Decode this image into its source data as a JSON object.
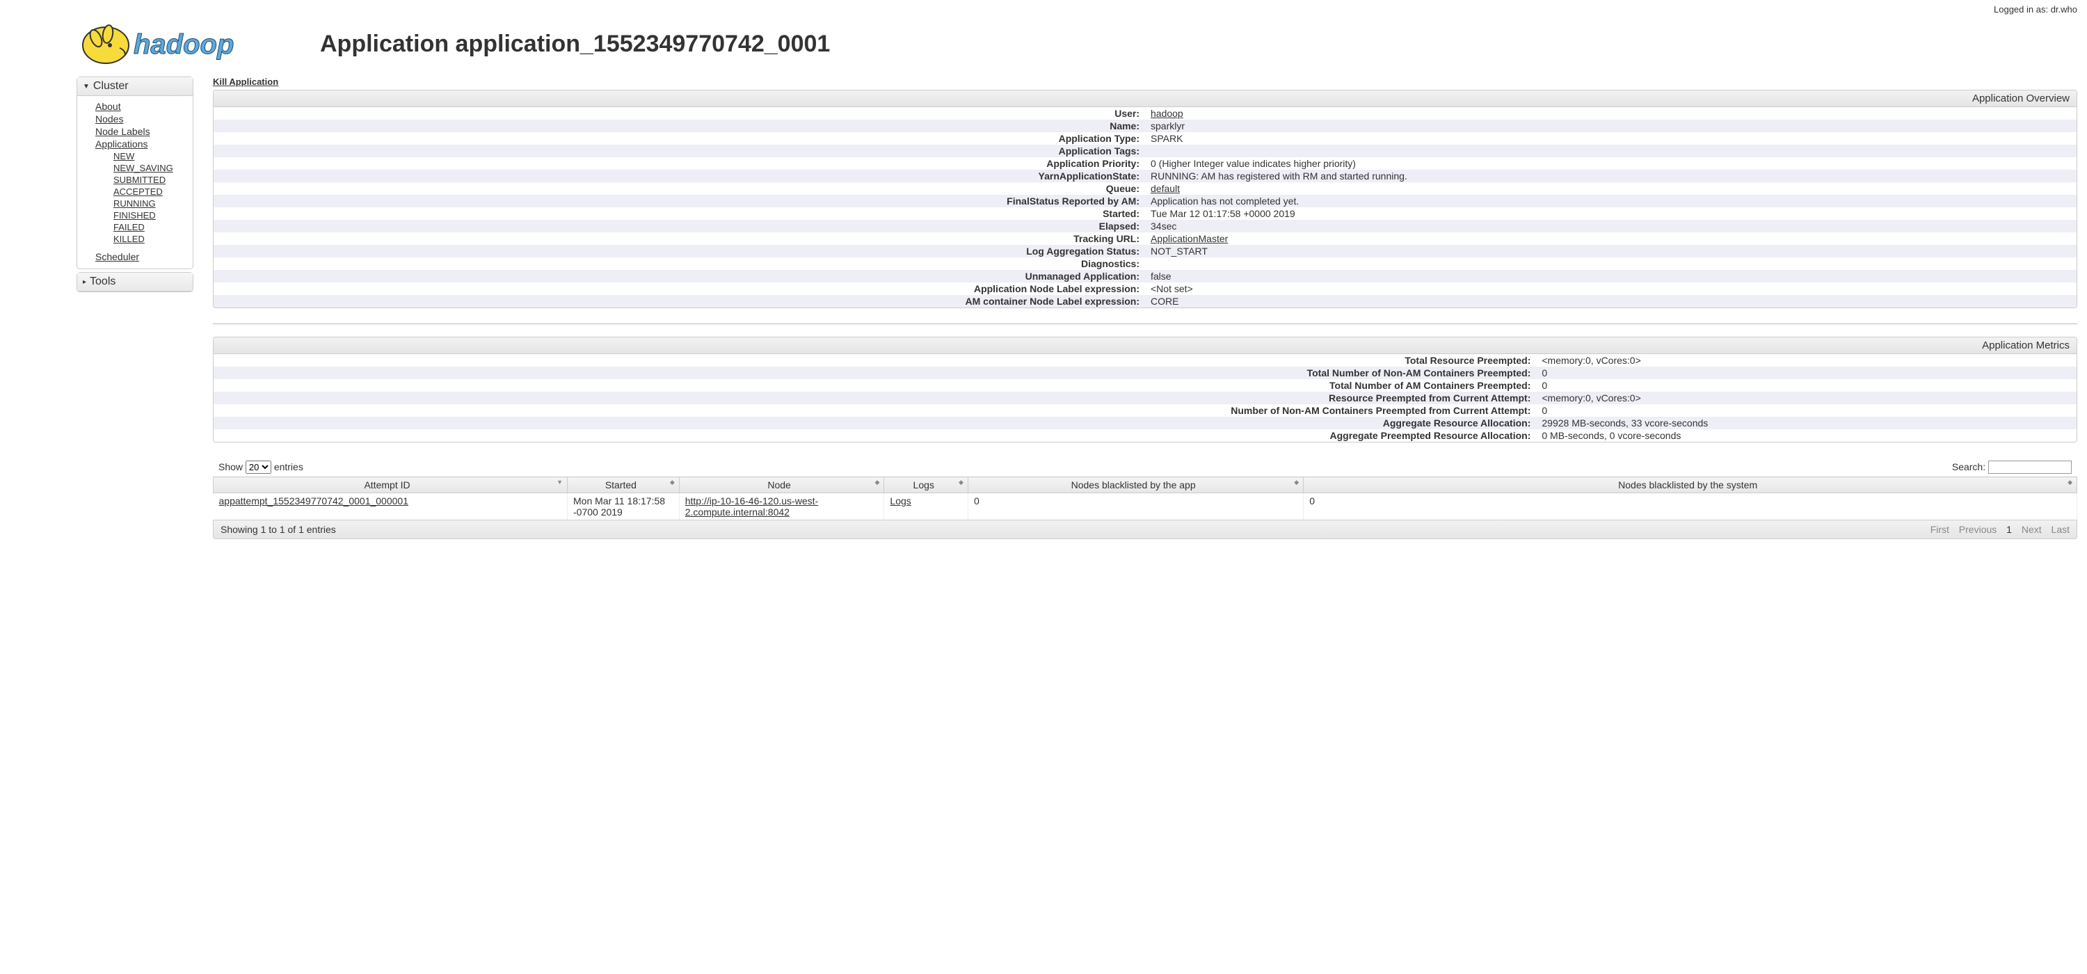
{
  "login": {
    "text": "Logged in as: dr.who"
  },
  "title": "Application application_1552349770742_0001",
  "sidebar": {
    "cluster": {
      "label": "Cluster",
      "links": {
        "about": "About",
        "nodes": "Nodes",
        "node_labels": "Node Labels",
        "applications": "Applications",
        "new": "NEW",
        "new_saving": "NEW_SAVING",
        "submitted": "SUBMITTED",
        "accepted": "ACCEPTED",
        "running": "RUNNING",
        "finished": "FINISHED",
        "failed": "FAILED",
        "killed": "KILLED",
        "scheduler": "Scheduler"
      }
    },
    "tools": {
      "label": "Tools"
    }
  },
  "kill_label": "Kill Application",
  "overview": {
    "title": "Application Overview",
    "rows": [
      {
        "label": "User:",
        "value": "hadoop",
        "link": true
      },
      {
        "label": "Name:",
        "value": "sparklyr"
      },
      {
        "label": "Application Type:",
        "value": "SPARK"
      },
      {
        "label": "Application Tags:",
        "value": ""
      },
      {
        "label": "Application Priority:",
        "value": "0 (Higher Integer value indicates higher priority)"
      },
      {
        "label": "YarnApplicationState:",
        "value": "RUNNING: AM has registered with RM and started running."
      },
      {
        "label": "Queue:",
        "value": "default",
        "link": true
      },
      {
        "label": "FinalStatus Reported by AM:",
        "value": "Application has not completed yet."
      },
      {
        "label": "Started:",
        "value": "Tue Mar 12 01:17:58 +0000 2019"
      },
      {
        "label": "Elapsed:",
        "value": "34sec"
      },
      {
        "label": "Tracking URL:",
        "value": "ApplicationMaster",
        "link": true
      },
      {
        "label": "Log Aggregation Status:",
        "value": "NOT_START"
      },
      {
        "label": "Diagnostics:",
        "value": ""
      },
      {
        "label": "Unmanaged Application:",
        "value": "false"
      },
      {
        "label": "Application Node Label expression:",
        "value": "<Not set>"
      },
      {
        "label": "AM container Node Label expression:",
        "value": "CORE"
      }
    ]
  },
  "metrics": {
    "title": "Application Metrics",
    "rows": [
      {
        "label": "Total Resource Preempted:",
        "value": "<memory:0, vCores:0>"
      },
      {
        "label": "Total Number of Non-AM Containers Preempted:",
        "value": "0"
      },
      {
        "label": "Total Number of AM Containers Preempted:",
        "value": "0"
      },
      {
        "label": "Resource Preempted from Current Attempt:",
        "value": "<memory:0, vCores:0>"
      },
      {
        "label": "Number of Non-AM Containers Preempted from Current Attempt:",
        "value": "0"
      },
      {
        "label": "Aggregate Resource Allocation:",
        "value": "29928 MB-seconds, 33 vcore-seconds"
      },
      {
        "label": "Aggregate Preempted Resource Allocation:",
        "value": "0 MB-seconds, 0 vcore-seconds"
      }
    ]
  },
  "table": {
    "show_label": "Show",
    "entries_label": "entries",
    "page_size": "20",
    "search_label": "Search:",
    "headers": {
      "attempt_id": "Attempt ID",
      "started": "Started",
      "node": "Node",
      "logs": "Logs",
      "bl_app": "Nodes blacklisted by the app",
      "bl_sys": "Nodes blacklisted by the system"
    },
    "row": {
      "attempt_id": "appattempt_1552349770742_0001_000001",
      "started": "Mon Mar 11 18:17:58 -0700 2019",
      "node": "http://ip-10-16-46-120.us-west-2.compute.internal:8042",
      "logs": "Logs",
      "bl_app": "0",
      "bl_sys": "0"
    },
    "info": "Showing 1 to 1 of 1 entries",
    "pager": {
      "first": "First",
      "prev": "Previous",
      "one": "1",
      "next": "Next",
      "last": "Last"
    }
  }
}
